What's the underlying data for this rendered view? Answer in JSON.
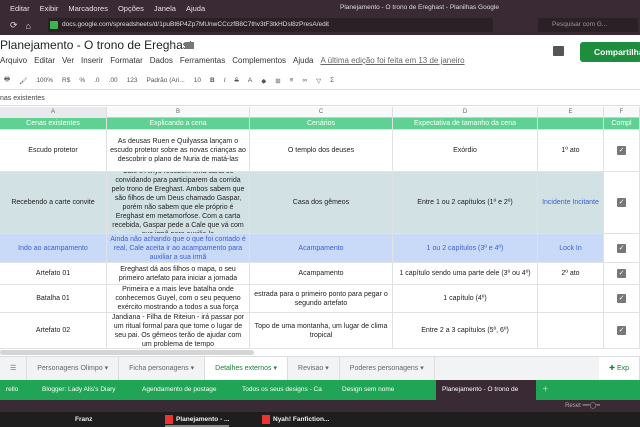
{
  "os_menu": [
    "Editar",
    "Exibir",
    "Marcadores",
    "Opções",
    "Janela",
    "Ajuda"
  ],
  "window_title": "Planejamento - O trono de Ereghast - Planilhas Google",
  "url": "docs.google.com/spreadsheets/d/1puBt6P4Zp7MUnwCCczfB8C7thv3tF3tkHDsl8zPresA/edit",
  "search_placeholder": "Pesquisar com G...",
  "doc_title": "Planejamento - O trono de Ereghast",
  "share_label": "Compartilhar",
  "menu": [
    "Arquivo",
    "Editar",
    "Ver",
    "Inserir",
    "Formatar",
    "Dados",
    "Ferramentas",
    "Complementos",
    "Ajuda"
  ],
  "last_edit": "A última edição foi feita em 13 de janeiro",
  "toolbar": {
    "zoom": "100%",
    "currency": "R$",
    "percent": "%",
    "dec_less": ".0",
    "dec_more": ".00",
    "format": "123",
    "font": "Padrão (Ari...",
    "size": "10",
    "bold": "B",
    "italic": "I",
    "strike": "S",
    "textcolor": "A"
  },
  "formula_bar": "nas existentes",
  "columns": [
    "A",
    "B",
    "C",
    "D",
    "E",
    "F"
  ],
  "header": [
    "Cenas existentes",
    "Explicando a cena",
    "Cenários",
    "Expectativa de tamanho da cena",
    "",
    "Compl"
  ],
  "rows": [
    {
      "a": "Escudo protetor",
      "b": "As deusas Ruen e Quilyassa lançam o escudo protetor sobre as novas crianças ao descobrir o plano de Nuria de matá-las",
      "c": "O templo dos deuses",
      "d": "Exórdio",
      "e": "1º ato",
      "done": true
    },
    {
      "a": "Recebendo a carte convite",
      "b": "Cale e Alnys recebem uma carta os convidando para participarem da corrida pelo trono de Ereghast. Ambos sabem que são filhos de um Deus chamado Gaspar, porém não sabem que ele próprio é Ereghast em metamorfose. Com a carta recebida, Gaspar pede a Cale que vá com sua irmã para auxilia-la",
      "c": "Casa dos gêmeos",
      "d": "Entre 1 ou 2 capítulos (1º e 2º)",
      "e": "Incidente Incitante",
      "done": true
    },
    {
      "a": "Indo ao acampamento",
      "b": "Ainda não achando que o que foi contado é real, Cale aceita ir ao acampamento para auxiliar a sua irmã",
      "c": "Acampamento",
      "d": "1 ou 2 capítulos (3º e 4º)",
      "e": "Lock In",
      "done": true
    },
    {
      "a": "Artefato 01",
      "b": "Ereghast dá aos filhos o mapa, o seu primeiro artefato para iniciar a jornada",
      "c": "Acampamento",
      "d": "1 capítulo sendo uma parte dele (3º ou 4º)",
      "e": "2º ato",
      "done": true
    },
    {
      "a": "Batalha 01",
      "b": "Primeira e a mais leve batalha onde conhecemos Guyel, com o seu pequeno exército mostrando a todos a sua força",
      "c": "estrada para o primeiro ponto para pegar o segundo artefato",
      "d": "1 capítulo (4º)",
      "e": "",
      "done": true
    },
    {
      "a": "Artefato 02",
      "b": "Jandiana - Filha de Riteiun - irá passar por um ritual formal para que tome o lugar de seu pai. Os gêmeos terão de ajudar com um problema de tempo",
      "c": "Topo de uma montanha, um lugar de clima tropical",
      "d": "Entre 2 a 3 capítulos (5º, 6º)",
      "e": "",
      "done": true
    }
  ],
  "sheet_tabs": [
    "Personagens Olimpo",
    "Ficha personagens",
    "Detalhes externos",
    "Revisao",
    "Poderes personagens"
  ],
  "active_sheet": "Detalhes externos",
  "explore": "Exp",
  "browser_tabs": [
    "rello",
    "Blogger: Lady Alis's Diary",
    "Agendamento de postage",
    "Todos os seus designs - Ca",
    "Design sem nome",
    "Planejamento - O trono de"
  ],
  "status_reset": "Reset",
  "taskbar": [
    "Franz",
    "Planejamento - ...",
    "Nyah! Fanfiction..."
  ],
  "colors": {
    "header_green": "#5fd193",
    "share_green": "#1e8e3e",
    "row_teal": "#d2e1e4",
    "row_blue": "#c9daf8"
  }
}
